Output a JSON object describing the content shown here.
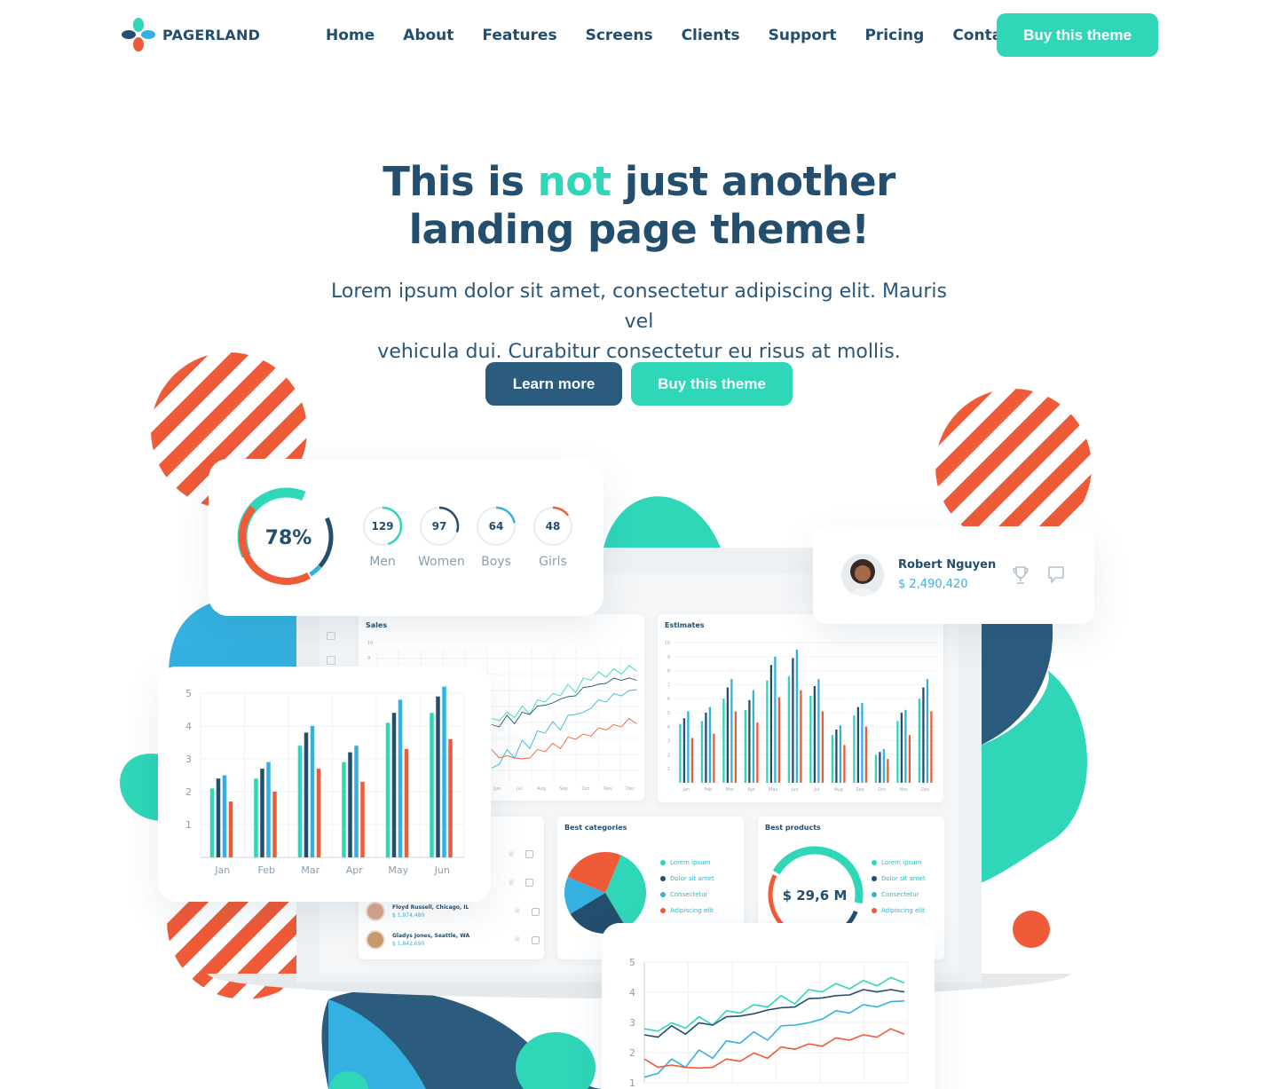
{
  "nav": {
    "brand": "PAGERLAND",
    "items": [
      "Home",
      "About",
      "Features",
      "Screens",
      "Clients",
      "Support",
      "Pricing",
      "Contact"
    ],
    "cta": "Buy this theme"
  },
  "hero": {
    "title_pre": "This is ",
    "title_accent": "not",
    "title_post": " just another",
    "title_line2": "landing page theme!",
    "subtitle_line1": "Lorem ipsum dolor sit amet, consectetur adipiscing elit. Mauris vel",
    "subtitle_line2": "vehicula dui. Curabitur consectetur eu risus at mollis.",
    "learn_more": "Learn more",
    "buy": "Buy this theme"
  },
  "stats_card": {
    "main_percent": "78%",
    "main_level": 0.78,
    "items": [
      {
        "value": "129",
        "label": "Men",
        "level": 0.45,
        "color": "#2fd6b8"
      },
      {
        "value": "97",
        "label": "Women",
        "level": 0.3,
        "color": "#234e6d"
      },
      {
        "value": "64",
        "label": "Boys",
        "level": 0.22,
        "color": "#34b1e0"
      },
      {
        "value": "48",
        "label": "Girls",
        "level": 0.15,
        "color": "#ef5a38"
      }
    ]
  },
  "profile_card": {
    "name": "Robert Nguyen",
    "amount": "$ 2,490,420",
    "icons": [
      "trophy-icon",
      "comment-icon"
    ]
  },
  "dashboard": {
    "sales_title": "Sales",
    "estimates_title": "Estimates",
    "best_categories_title": "Best categories",
    "best_products_title": "Best products",
    "product_total": "$ 29,6 M",
    "legend": [
      "Lorem ipsum",
      "Dolor sit amet",
      "Consectetur",
      "Adipiscing elit"
    ],
    "sales_ticks": [
      "10",
      "9"
    ],
    "estimate_ticks": [
      "10",
      "9",
      "8",
      "7",
      "6",
      "5",
      "4",
      "3",
      "2",
      "1"
    ],
    "months_short": [
      "Jan",
      "Feb",
      "Mar",
      "Apr",
      "May",
      "Jun",
      "Jul",
      "Aug",
      "Sep",
      "Oct",
      "Nov",
      "Dec"
    ],
    "sales_visible_months": [
      "Jun",
      "Jul",
      "Aug",
      "Sep",
      "Oct",
      "Nov",
      "Dec"
    ],
    "people": [
      {
        "name": "Floyd Russell, Chicago, IL",
        "amount": "$ 1,974,480"
      },
      {
        "name": "Gladys Jones, Seattle, WA",
        "amount": "$ 1,842,690"
      }
    ]
  },
  "colors": {
    "teal": "#2fd6b8",
    "navy": "#234e6d",
    "blue": "#34b1e0",
    "orange": "#ef5a38"
  },
  "chart_data": [
    {
      "type": "bar",
      "categories": [
        "Jan",
        "Feb",
        "Mar",
        "Apr",
        "May",
        "Jun"
      ],
      "ylim": [
        0,
        5
      ],
      "yticks": [
        "1",
        "2",
        "3",
        "4",
        "5"
      ],
      "series": [
        {
          "values": [
            2.1,
            2.4,
            3.4,
            2.9,
            4.1,
            4.4
          ],
          "color": "#2fd6b8"
        },
        {
          "values": [
            2.4,
            2.7,
            3.8,
            3.2,
            4.4,
            4.9
          ],
          "color": "#234e6d"
        },
        {
          "values": [
            2.5,
            2.9,
            4.0,
            3.4,
            4.8,
            5.2
          ],
          "color": "#34b1e0"
        },
        {
          "values": [
            1.7,
            2.0,
            2.7,
            2.3,
            3.3,
            3.6
          ],
          "color": "#ef5a38"
        }
      ]
    },
    {
      "type": "line",
      "ylim": [
        1,
        5
      ],
      "yticks": [
        "1",
        "2",
        "3",
        "4",
        "5"
      ],
      "series": [
        {
          "values": [
            2.7,
            2.8,
            2.9,
            2.9,
            3.1,
            3.0,
            3.3,
            3.4,
            3.5,
            3.6,
            3.8,
            3.7,
            4.0,
            4.1,
            4.2,
            4.2,
            4.3,
            4.3,
            4.4,
            4.4
          ],
          "color": "#2fd6b8"
        },
        {
          "values": [
            2.5,
            2.6,
            2.8,
            2.7,
            2.9,
            3.0,
            3.1,
            3.3,
            3.2,
            3.5,
            3.4,
            3.6,
            3.7,
            3.9,
            3.8,
            4.0,
            4.0,
            4.1,
            4.0,
            4.1
          ],
          "color": "#234e6d"
        },
        {
          "values": [
            1.1,
            1.4,
            1.7,
            1.6,
            2.0,
            1.9,
            2.3,
            2.4,
            2.6,
            2.5,
            2.8,
            3.0,
            2.9,
            3.2,
            3.3,
            3.4,
            3.5,
            3.6,
            3.6,
            3.8
          ],
          "color": "#34b1e0"
        },
        {
          "values": [
            1.7,
            1.6,
            1.5,
            1.6,
            1.4,
            1.6,
            1.7,
            1.8,
            1.9,
            1.9,
            2.1,
            2.2,
            2.2,
            2.3,
            2.4,
            2.5,
            2.5,
            2.6,
            2.7,
            2.7
          ],
          "color": "#ef5a38"
        }
      ]
    },
    {
      "type": "bar",
      "categories": [
        "Jan",
        "Feb",
        "Mar",
        "Apr",
        "May",
        "Jun",
        "Jul",
        "Aug",
        "Sep",
        "Oct",
        "Nov",
        "Dec"
      ],
      "ylim": [
        0,
        10
      ],
      "series": [
        {
          "values": [
            4.2,
            4.4,
            6.0,
            5.2,
            7.3,
            7.6,
            6.2,
            3.4,
            4.8,
            2.0,
            4.4,
            6.0
          ],
          "color": "#2fd6b8"
        },
        {
          "values": [
            4.6,
            5.0,
            6.8,
            5.9,
            8.4,
            8.9,
            6.9,
            3.8,
            5.4,
            2.2,
            5.0,
            6.8
          ],
          "color": "#234e6d"
        },
        {
          "values": [
            5.1,
            5.4,
            7.4,
            6.6,
            9.0,
            9.5,
            7.4,
            4.1,
            5.7,
            2.4,
            5.2,
            7.4
          ],
          "color": "#34b1e0"
        },
        {
          "values": [
            3.2,
            3.5,
            5.1,
            4.3,
            6.1,
            6.6,
            5.1,
            2.7,
            4.0,
            1.7,
            3.4,
            5.1
          ],
          "color": "#ef5a38"
        }
      ]
    },
    {
      "type": "pie",
      "values": [
        35,
        25,
        15,
        25
      ],
      "colors": [
        "#2fd6b8",
        "#234e6d",
        "#34b1e0",
        "#ef5a38"
      ]
    }
  ]
}
